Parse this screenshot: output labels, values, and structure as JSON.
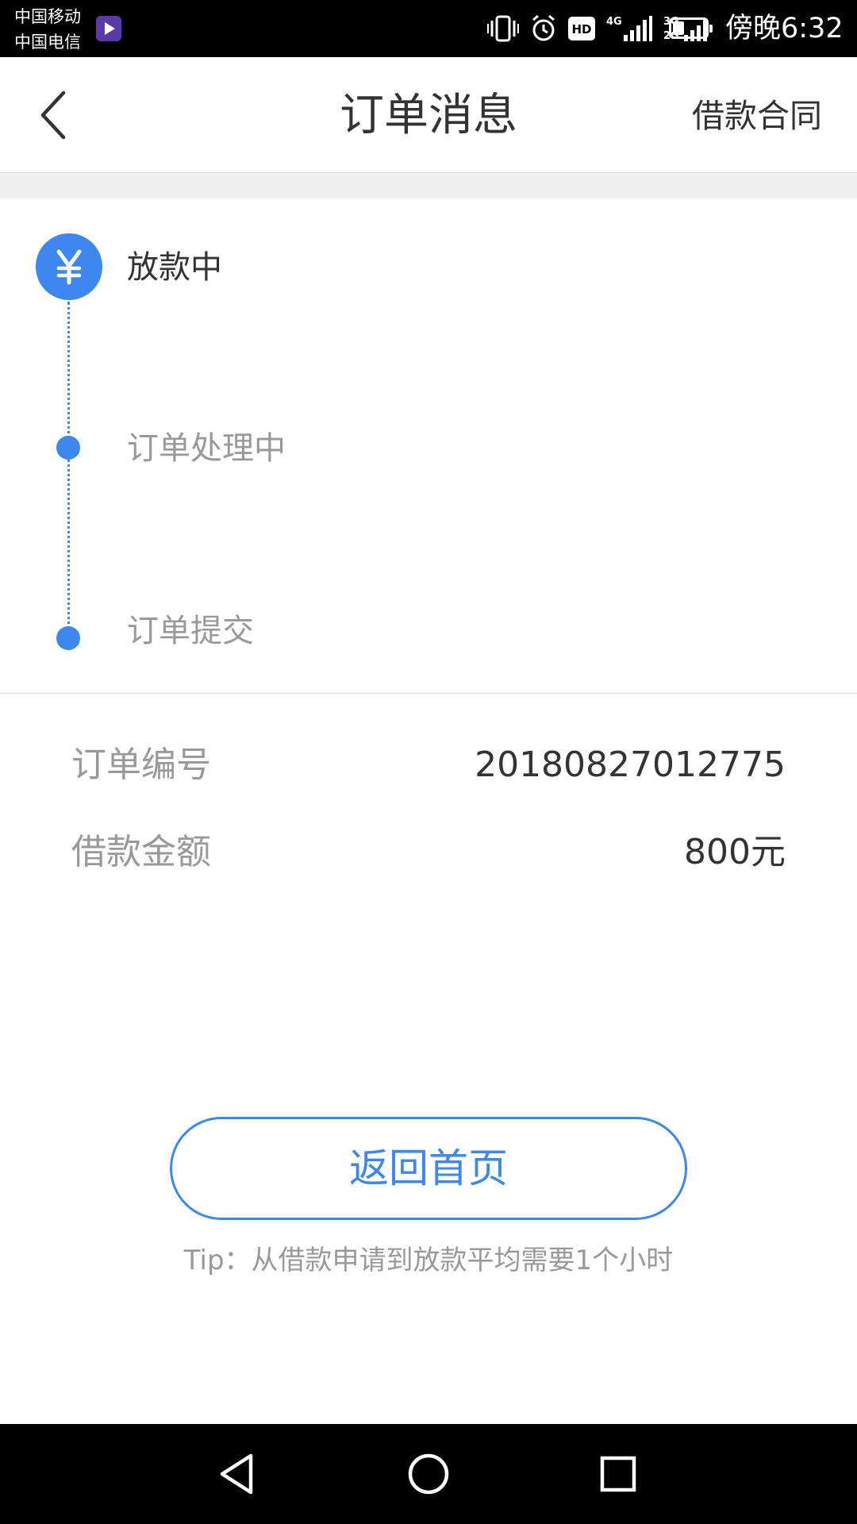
{
  "status_bar": {
    "carrier_1": "中国移动",
    "carrier_2": "中国电信",
    "icons": [
      "app-notification-icon",
      "vibrate-icon",
      "alarm-icon",
      "hd-icon",
      "signal-4g-icon",
      "signal-3g-2g-icon",
      "battery-icon"
    ],
    "network_1": "4G",
    "network_2a": "3G",
    "network_2b": "2G",
    "hd_label": "HD",
    "time": "傍晚6:32"
  },
  "header": {
    "title": "订单消息",
    "right_link": "借款合同",
    "back_icon": "chevron-left-icon"
  },
  "timeline": {
    "current_icon": "yen-icon",
    "steps": [
      {
        "label": "放款中",
        "state": "current"
      },
      {
        "label": "订单处理中",
        "state": "done"
      },
      {
        "label": "订单提交",
        "state": "done"
      }
    ]
  },
  "details": [
    {
      "label": "订单编号",
      "value": "20180827012775"
    },
    {
      "label": "借款金额",
      "value": "800元"
    }
  ],
  "actions": {
    "home_button": "返回首页",
    "tip": "Tip：从借款申请到放款平均需要1个小时"
  },
  "android_nav": {
    "icons": [
      "back-triangle-icon",
      "home-circle-icon",
      "recents-square-icon"
    ]
  },
  "colors": {
    "accent": "#3d87ef",
    "primary_text": "#333333",
    "secondary_text": "#999999",
    "divider": "#dcdcdc",
    "band": "#f0f0f0"
  }
}
